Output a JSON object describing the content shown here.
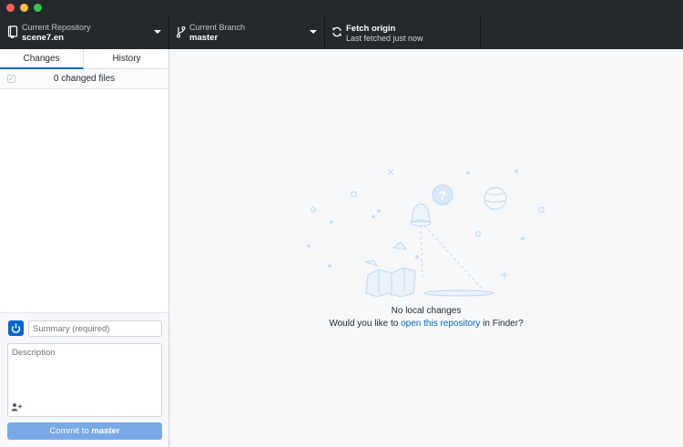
{
  "toolbar": {
    "repo_title": "Current Repository",
    "repo_value": "scene7.en",
    "branch_title": "Current Branch",
    "branch_value": "master",
    "fetch_title": "Fetch origin",
    "fetch_status": "Last fetched just now"
  },
  "tabs": [
    {
      "label": "Changes",
      "selected": true
    },
    {
      "label": "History",
      "selected": false
    }
  ],
  "changes": {
    "files_label": "0 changed files",
    "checked": true
  },
  "commit": {
    "summary_placeholder": "Summary (required)",
    "description_placeholder": "Description",
    "button_prefix": "Commit to ",
    "button_branch": "master"
  },
  "main": {
    "no_changes": "No local changes",
    "open_prefix": "Would you like to ",
    "open_link": "open this repository",
    "open_suffix": " in Finder?"
  },
  "colors": {
    "toolbar_bg": "#24292e",
    "accent": "#0366d6",
    "commit_button": "#79a9e6"
  }
}
